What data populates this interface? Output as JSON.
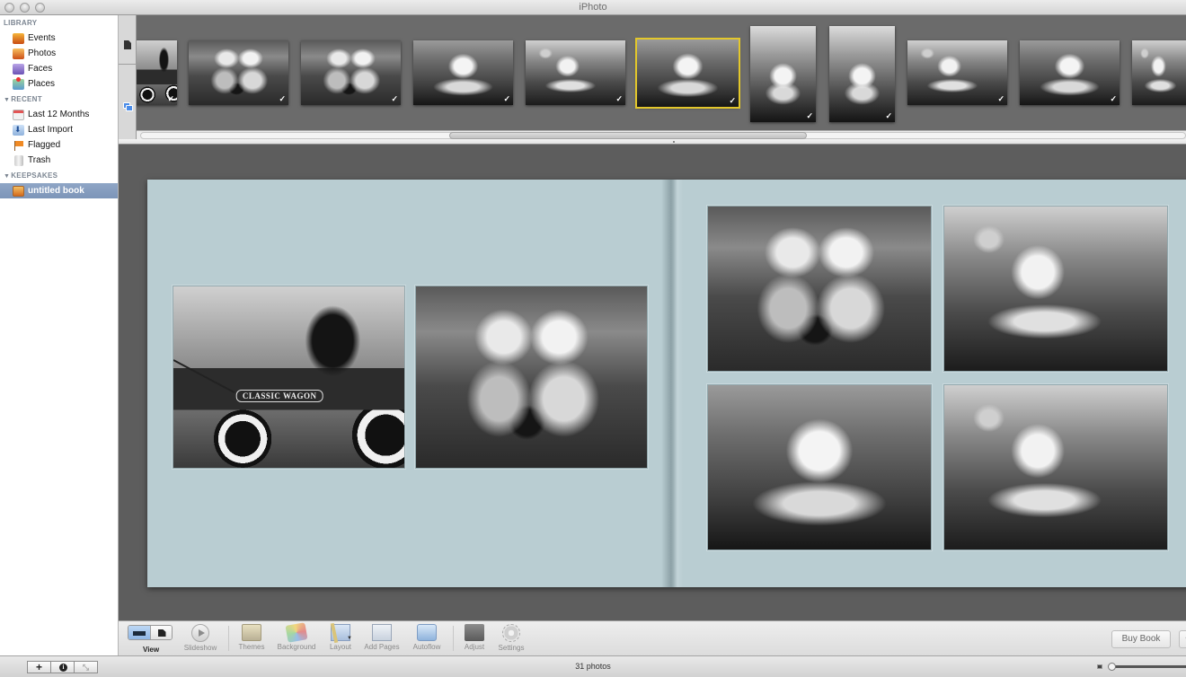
{
  "window": {
    "title": "iPhoto"
  },
  "sidebar": {
    "sections": [
      {
        "heading": "LIBRARY",
        "collapsible": false,
        "items": [
          {
            "label": "Events",
            "icon": "events-icon"
          },
          {
            "label": "Photos",
            "icon": "photos-icon"
          },
          {
            "label": "Faces",
            "icon": "faces-icon"
          },
          {
            "label": "Places",
            "icon": "places-icon"
          }
        ]
      },
      {
        "heading": "RECENT",
        "collapsible": true,
        "items": [
          {
            "label": "Last 12 Months",
            "icon": "calendar-icon"
          },
          {
            "label": "Last Import",
            "icon": "import-icon"
          },
          {
            "label": "Flagged",
            "icon": "flag-icon"
          },
          {
            "label": "Trash",
            "icon": "trash-icon"
          }
        ]
      },
      {
        "heading": "KEEPSAKES",
        "collapsible": true,
        "items": [
          {
            "label": "untitled book",
            "icon": "book-icon",
            "selected": true
          }
        ]
      }
    ]
  },
  "filmstrip": {
    "thumbnails": [
      {
        "subject": "wagon and dog",
        "orientation": "landscape",
        "placed": true,
        "selected": false
      },
      {
        "subject": "two girls with dog",
        "orientation": "landscape",
        "placed": true,
        "selected": false
      },
      {
        "subject": "two girls with dog",
        "orientation": "landscape",
        "placed": true,
        "selected": false
      },
      {
        "subject": "girl lying in grass",
        "orientation": "landscape",
        "placed": true,
        "selected": false
      },
      {
        "subject": "girl lying in grass",
        "orientation": "landscape",
        "placed": true,
        "selected": false
      },
      {
        "subject": "girl lying in grass",
        "orientation": "landscape",
        "placed": true,
        "selected": true
      },
      {
        "subject": "girl lying in grass",
        "orientation": "portrait",
        "placed": true,
        "selected": false
      },
      {
        "subject": "girl lying in grass",
        "orientation": "portrait",
        "placed": true,
        "selected": false
      },
      {
        "subject": "girl lying in grass",
        "orientation": "landscape",
        "placed": true,
        "selected": false
      },
      {
        "subject": "girl lying in grass",
        "orientation": "landscape",
        "placed": true,
        "selected": false
      },
      {
        "subject": "girl lying in grass",
        "orientation": "landscape",
        "placed": false,
        "selected": false
      }
    ],
    "check_glyph": "✓"
  },
  "book": {
    "background_color": "#b9cdd2",
    "left_page": {
      "photos": [
        {
          "subject": "dog in wagon",
          "wagon_label": "CLASSIC WAGON"
        },
        {
          "subject": "two girls with dog"
        }
      ]
    },
    "right_page": {
      "photos": [
        {
          "subject": "two girls with dog"
        },
        {
          "subject": "girl lying in grass"
        },
        {
          "subject": "girl lying in grass"
        },
        {
          "subject": "girl lying in grass"
        }
      ]
    }
  },
  "toolbar": {
    "view_label": "View",
    "buttons": [
      {
        "label": "Slideshow",
        "icon": "play-icon"
      },
      {
        "label": "Themes",
        "icon": "themes-icon"
      },
      {
        "label": "Background",
        "icon": "background-icon"
      },
      {
        "label": "Layout",
        "icon": "layout-icon"
      },
      {
        "label": "Add Pages",
        "icon": "add-pages-icon"
      },
      {
        "label": "Autoflow",
        "icon": "autoflow-icon"
      },
      {
        "label": "Adjust",
        "icon": "adjust-icon"
      },
      {
        "label": "Settings",
        "icon": "settings-icon"
      }
    ],
    "buy_book_label": "Buy Book",
    "more_label": "+"
  },
  "statusbar": {
    "add_label": "+",
    "photo_count": "31 photos"
  }
}
